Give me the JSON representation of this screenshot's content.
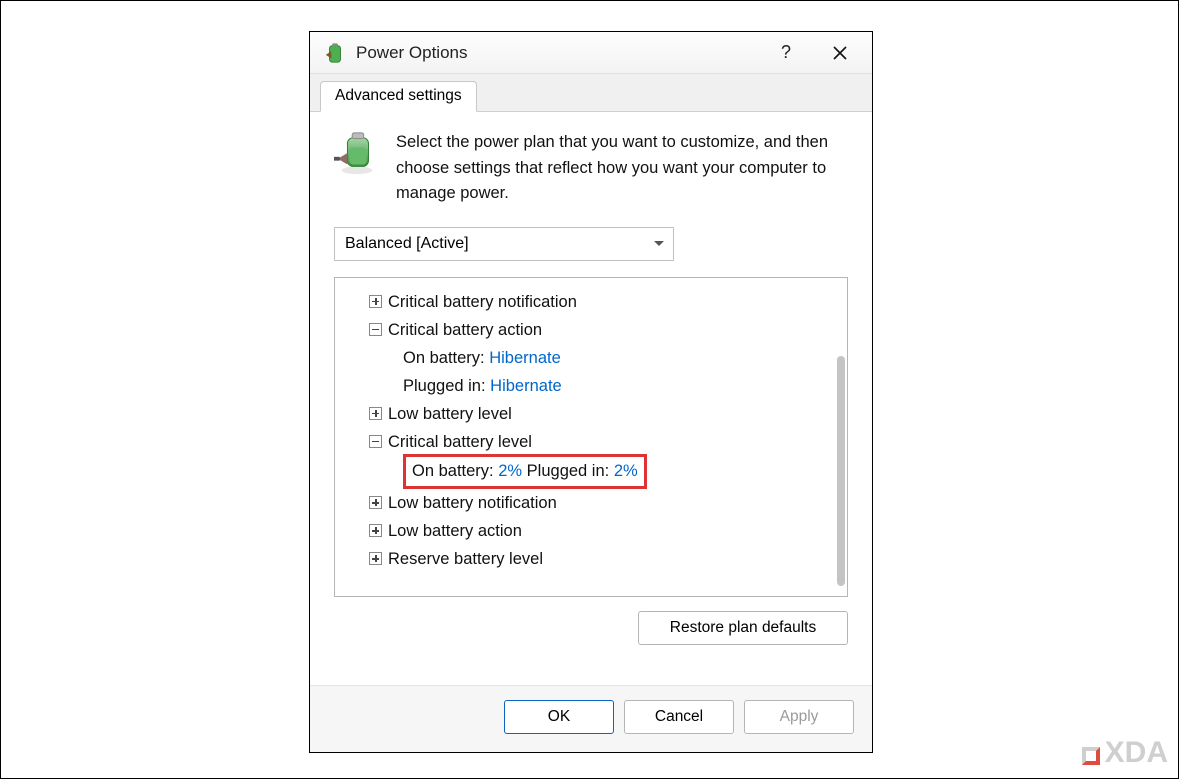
{
  "window": {
    "title": "Power Options",
    "help_tooltip": "?",
    "close_tooltip": "Close"
  },
  "tabs": {
    "advanced": "Advanced settings"
  },
  "intro": "Select the power plan that you want to customize, and then choose settings that reflect how you want your computer to manage power.",
  "plan_selector": {
    "selected": "Balanced [Active]",
    "options": [
      "Balanced [Active]"
    ]
  },
  "tree": {
    "items": [
      {
        "label": "Critical battery notification",
        "expanded": false
      },
      {
        "label": "Critical battery action",
        "expanded": true,
        "children": [
          {
            "key": "On battery",
            "value": "Hibernate"
          },
          {
            "key": "Plugged in",
            "value": "Hibernate"
          }
        ]
      },
      {
        "label": "Low battery level",
        "expanded": false
      },
      {
        "label": "Critical battery level",
        "expanded": true,
        "highlight": true,
        "children": [
          {
            "key": "On battery",
            "value": "2%"
          },
          {
            "key": "Plugged in",
            "value": "2%"
          }
        ]
      },
      {
        "label": "Low battery notification",
        "expanded": false
      },
      {
        "label": "Low battery action",
        "expanded": false
      },
      {
        "label": "Reserve battery level",
        "expanded": false
      }
    ]
  },
  "buttons": {
    "restore": "Restore plan defaults",
    "ok": "OK",
    "cancel": "Cancel",
    "apply": "Apply"
  },
  "watermark": "XDA"
}
